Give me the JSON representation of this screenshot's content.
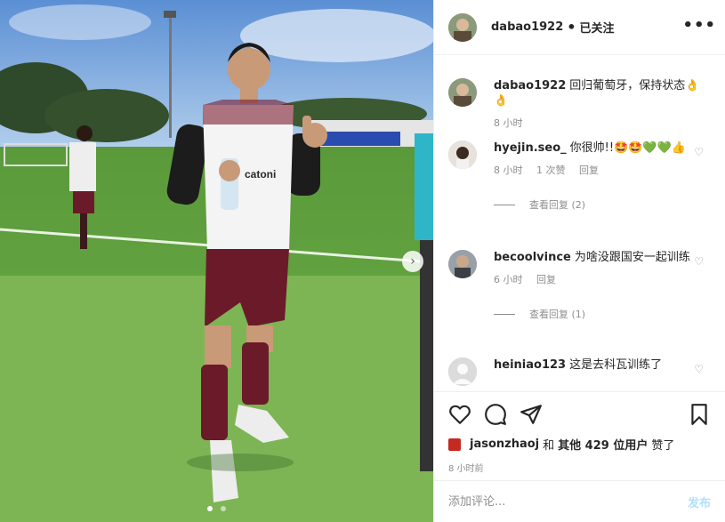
{
  "header": {
    "username": "dabao1922",
    "separator": "•",
    "follow_status": "已关注",
    "more": "•••"
  },
  "caption": {
    "username": "dabao1922",
    "text": "回归葡萄牙，保持状态👌👌",
    "time": "8 小时"
  },
  "comments": [
    {
      "username": "hyejin.seo_",
      "text": "你很帅!!🤩🤩💚💚👍",
      "time": "8 小时",
      "likes": "1 次赞",
      "reply": "回复",
      "view_replies": "查看回复 (2)"
    },
    {
      "username": "becoolvince",
      "text": "为啥没跟国安一起训练",
      "time": "6 小时",
      "reply": "回复",
      "view_replies": "查看回复 (1)"
    },
    {
      "username": "heiniao123",
      "text": "这是去科瓦训练了"
    }
  ],
  "likes": {
    "user": "jasonzhaoj",
    "connector": "和",
    "others": "其他 429 位用户",
    "suffix": "赞了"
  },
  "post_time": "8 小时前",
  "comment_input": {
    "placeholder": "添加评论..."
  },
  "post_button": "发布",
  "photo": {
    "bib_text": "catoni",
    "next_arrow": "›"
  },
  "icons": [
    "heart-icon",
    "comment-icon",
    "share-icon",
    "bookmark-icon",
    "more-icon",
    "next-arrow-icon"
  ],
  "colors": {
    "link_blue_disabled": "#b2dffc",
    "muted_text": "#8e8e8e",
    "text": "#262626",
    "border": "#efefef"
  }
}
